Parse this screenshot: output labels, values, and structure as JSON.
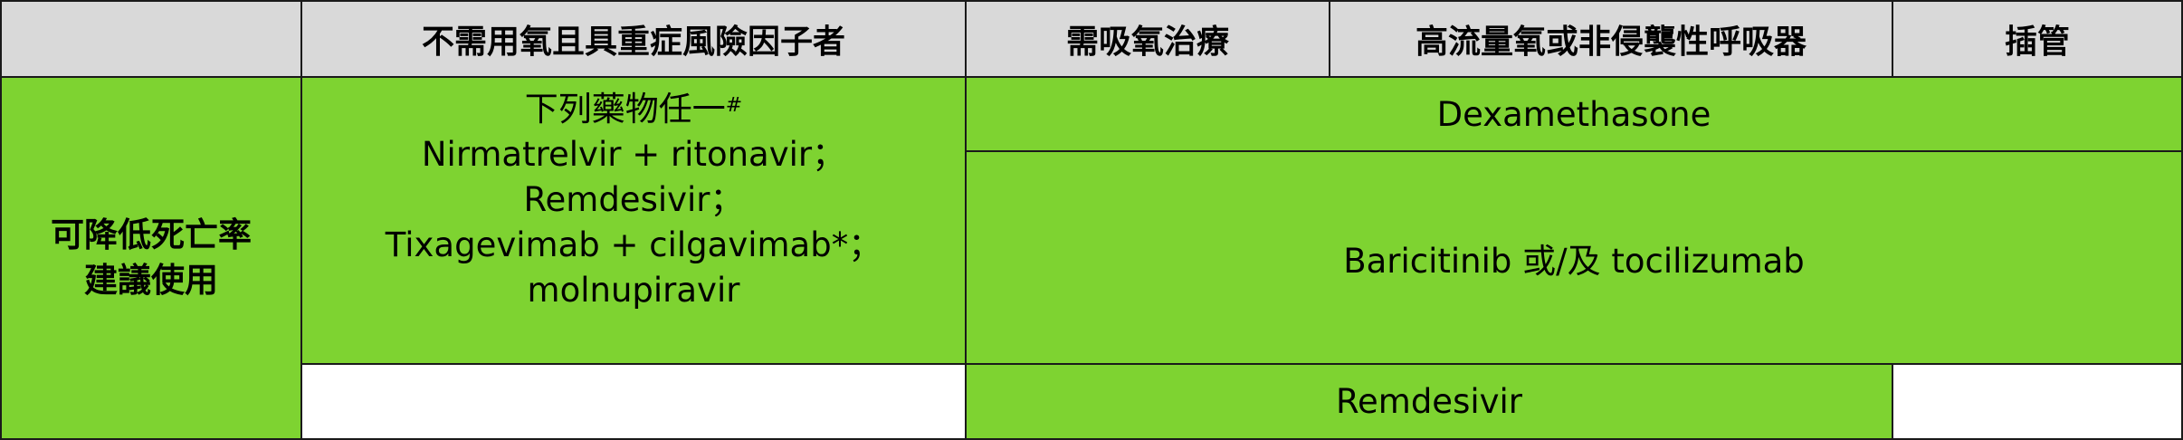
{
  "colors": {
    "header_bg": "#d9d9d9",
    "green": "#7ed331",
    "border": "#1a1a1a",
    "empty": "#ffffff"
  },
  "header": {
    "corner": "",
    "col1": "不需用氧且具重症風險因子者",
    "col2": "需吸氧治療",
    "col3": "高流量氧或非侵襲性呼吸器",
    "col4": "插管"
  },
  "row": {
    "label_line1": "可降低死亡率",
    "label_line2": "建議使用"
  },
  "cells": {
    "col1_intro": "下列藥物任一",
    "col1_intro_mark": "#",
    "col1_line1": "Nirmatrelvir + ritonavir；",
    "col1_line2": "Remdesivir；",
    "col1_line3": "Tixagevimab + cilgavimab*；",
    "col1_line4": "molnupiravir",
    "dexamethasone": "Dexamethasone",
    "baricitinib": "Baricitinib 或/及 tocilizumab",
    "remdesivir": "Remdesivir"
  }
}
